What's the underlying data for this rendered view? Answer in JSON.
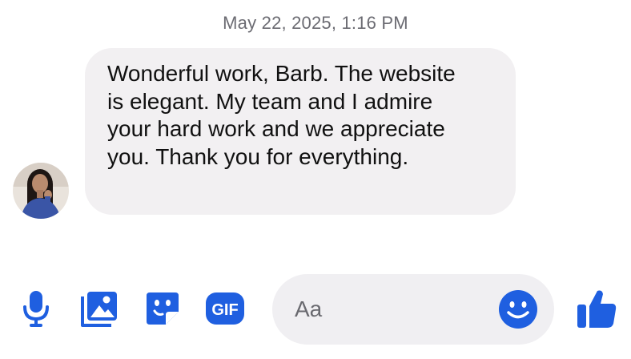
{
  "thread": {
    "timestamp": "May 22, 2025, 1:16 PM"
  },
  "message": {
    "text": "Wonderful work, Barb. The website\nis elegant. My team and I admire\nyour hard work and we appreciate\nyou. Thank you for everything."
  },
  "composer": {
    "placeholder": "Aa"
  },
  "toolbar": {
    "gif_label": "GIF"
  },
  "colors": {
    "accent": "#1f5fe0",
    "bubble": "#f2f0f2",
    "composer_bg": "#f0eff2",
    "timestamp": "#6b6b72"
  },
  "icons": {
    "mic": "microphone-icon",
    "photo": "photo-icon",
    "sticker": "sticker-icon",
    "gif": "gif-icon",
    "emoji": "emoji-icon",
    "like": "thumbs-up-icon"
  }
}
